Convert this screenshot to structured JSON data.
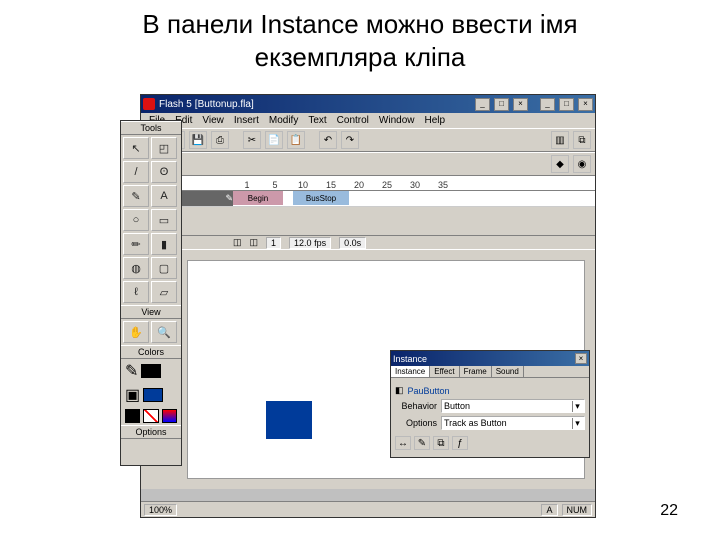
{
  "slide": {
    "title": "В панели Instance можно ввести імя\nекземпляра кліпа",
    "page_number": "22"
  },
  "window": {
    "title_app": "Flash 5",
    "title_file": "[Buttonup.fla]",
    "control_min": "_",
    "control_max": "□",
    "control_close": "×"
  },
  "menu": {
    "file": "File",
    "edit": "Edit",
    "view": "View",
    "insert": "Insert",
    "modify": "Modify",
    "text": "Text",
    "control": "Control",
    "window": "Window",
    "help": "Help"
  },
  "timeline": {
    "ruler": [
      "1",
      "5",
      "10",
      "15",
      "20",
      "25",
      "30",
      "35"
    ],
    "label_begin": "Begin",
    "label_busstop": "BusStop",
    "status_frame": "1",
    "status_fps": "12.0 fps",
    "status_time": "0.0s"
  },
  "tools": {
    "label_tools": "Tools",
    "label_view": "View",
    "label_colors": "Colors",
    "label_options": "Options",
    "icons": {
      "arrow": "↖",
      "subselect": "◰",
      "line": "/",
      "lasso": "ʘ",
      "pen": "✎",
      "text": "A",
      "oval": "○",
      "rect": "▭",
      "pencil": "✏",
      "brush": "▮",
      "ink": "◍",
      "paint": "▢",
      "eyedrop": "ℓ",
      "eraser": "▱",
      "hand": "✋",
      "zoom": "🔍"
    }
  },
  "instance_panel": {
    "title": "Instance",
    "tab_instance": "Instance",
    "tab_effect": "Effect",
    "tab_frame": "Frame",
    "tab_sound": "Sound",
    "symbol_name": "PauButton",
    "label_behavior": "Behavior",
    "value_behavior": "Button",
    "label_options": "Options",
    "value_options": "Track as Button"
  },
  "statusbar": {
    "zoom": "100%",
    "glyph_a": "A",
    "caps": "NUM"
  }
}
